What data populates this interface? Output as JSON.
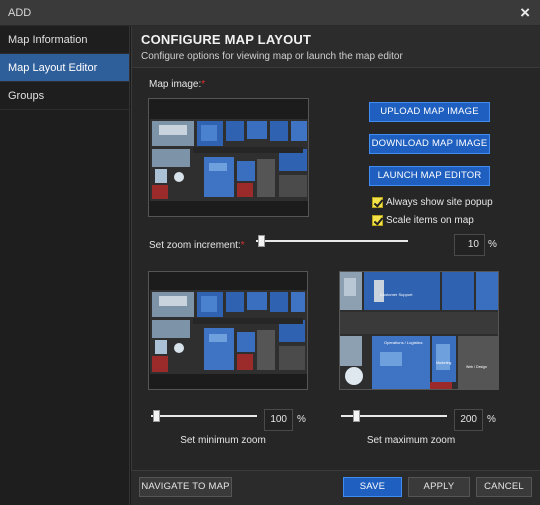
{
  "titlebar": {
    "title": "ADD",
    "close_glyph": "×"
  },
  "sidebar": {
    "items": [
      {
        "label": "Map Information",
        "active": false
      },
      {
        "label": "Map Layout Editor",
        "active": true
      },
      {
        "label": "Groups",
        "active": false
      }
    ]
  },
  "header": {
    "title": "CONFIGURE MAP LAYOUT",
    "subtitle": "Configure options for viewing map or launch the map editor"
  },
  "map_image": {
    "label": "Map image:",
    "required_mark": "*"
  },
  "buttons": {
    "upload": "UPLOAD MAP IMAGE",
    "download": "DOWNLOAD MAP IMAGE",
    "launch": "LAUNCH MAP EDITOR"
  },
  "options": {
    "always_show_site_popup": {
      "label": "Always show site popup",
      "checked": true
    },
    "scale_items_on_map": {
      "label": "Scale items on map",
      "checked": true
    }
  },
  "zoom_increment": {
    "label": "Set zoom increment:",
    "required_mark": "*",
    "value": "10",
    "unit": "%"
  },
  "min_zoom": {
    "value": "100",
    "unit": "%",
    "caption": "Set minimum zoom"
  },
  "max_zoom": {
    "value": "200",
    "unit": "%",
    "caption": "Set maximum zoom"
  },
  "floorplan_labels": {
    "customer_support": "Customer Support",
    "operations": "Operations / Logistics",
    "marketing": "Marketing",
    "web_design": "Web / Design"
  },
  "footer": {
    "navigate": "NAVIGATE TO MAP",
    "save": "SAVE",
    "apply": "APPLY",
    "cancel": "CANCEL"
  },
  "colors": {
    "accent": "#1f5fbf",
    "sidebar_active": "#2f5f9a",
    "checkbox": "#f3e24a",
    "required": "#e03030"
  }
}
